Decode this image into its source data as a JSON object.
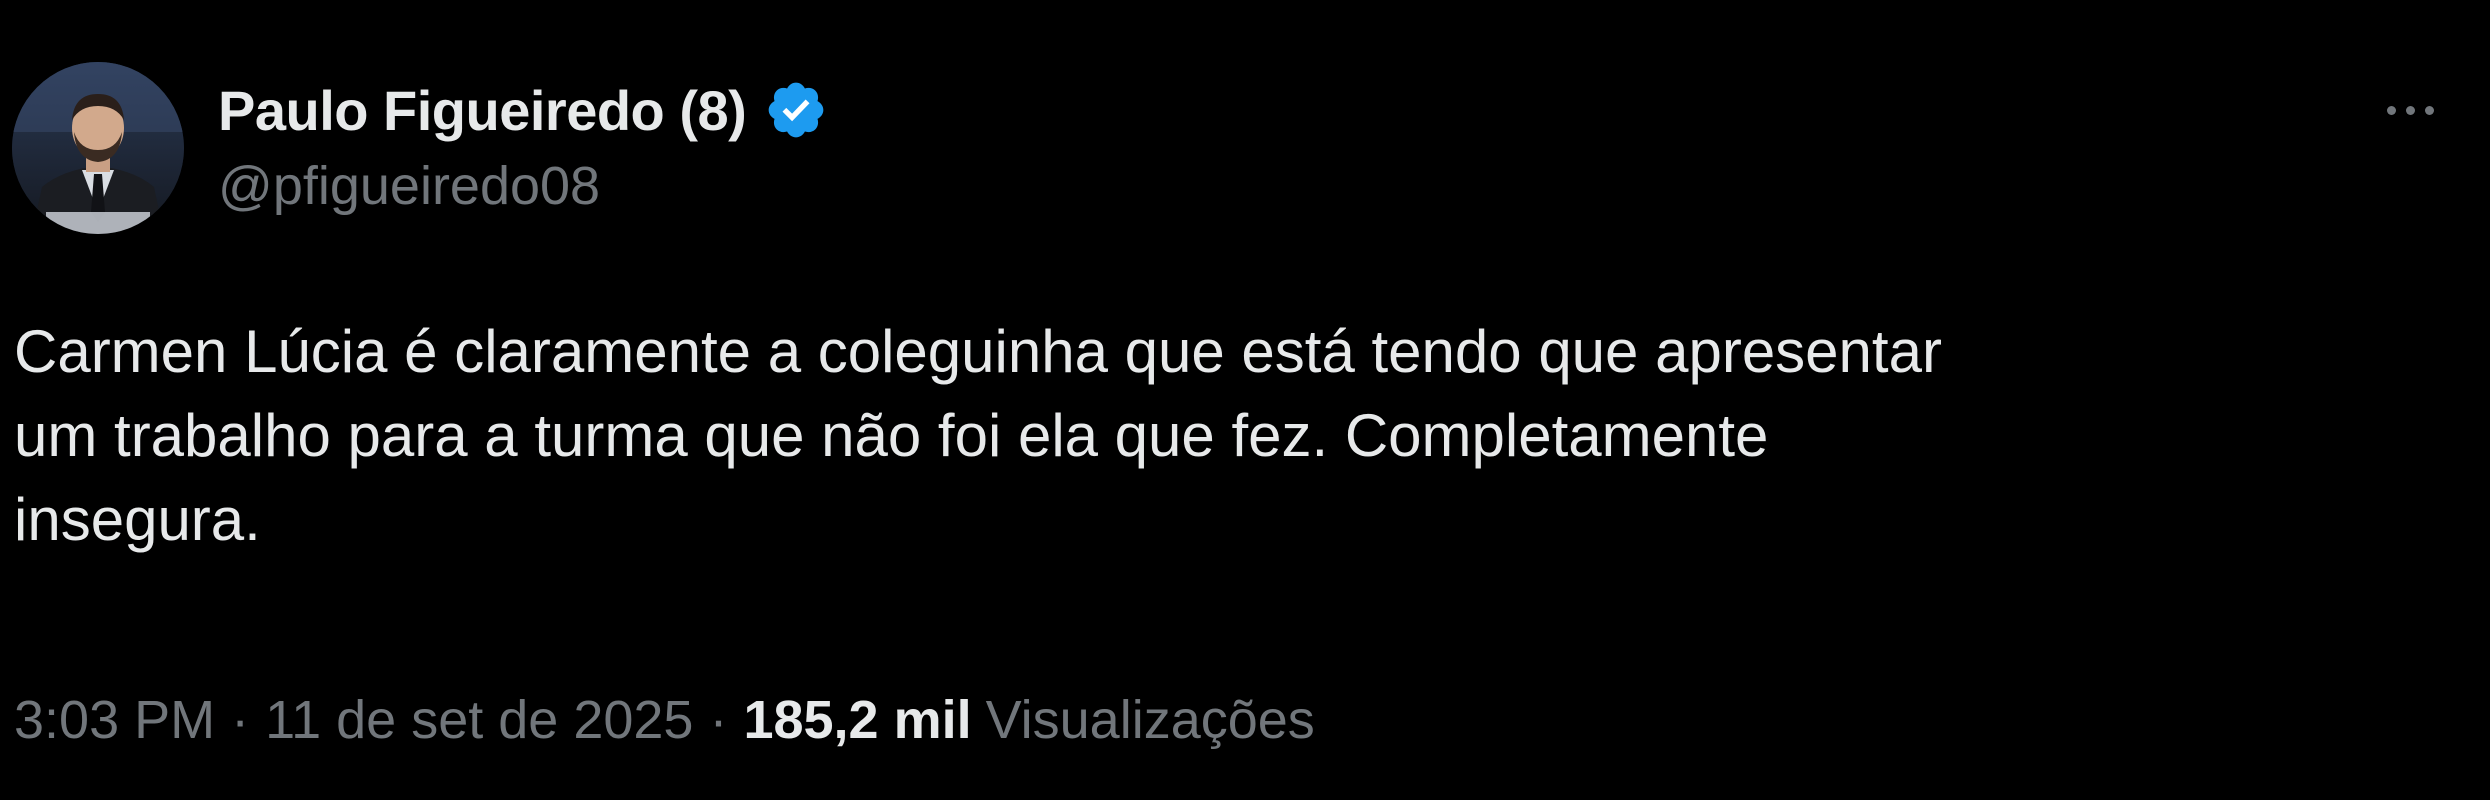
{
  "author": {
    "display_name": "Paulo Figueiredo (8)",
    "handle": "@pfigueiredo08",
    "verified": true
  },
  "tweet": {
    "text_lines": [
      "Carmen Lúcia é claramente a coleguinha que está tendo que apresentar",
      "um trabalho para a turma que não foi ela que fez. Completamente",
      "insegura."
    ]
  },
  "meta": {
    "time": "3:03 PM",
    "separator": "·",
    "date": "11 de set de 2025",
    "views_count": "185,2 mil",
    "views_label": "Visualizações"
  },
  "icons": {
    "verified": "verified-badge-icon",
    "more": "more-horizontal-icon",
    "avatar": "profile-avatar"
  },
  "colors": {
    "background": "#000000",
    "primary_text": "#e7e9ea",
    "secondary_text": "#71767b",
    "verified_blue": "#1d9bf0"
  }
}
